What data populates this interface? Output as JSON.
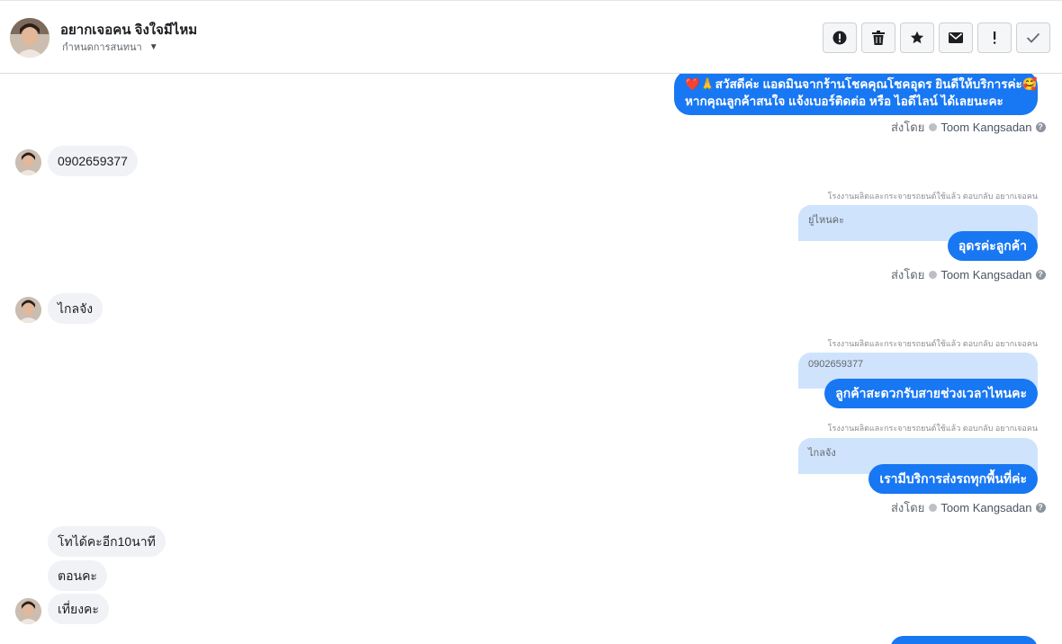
{
  "header": {
    "name": "อยากเจอคน จิงใจมีไหม",
    "subtitle": "กำหนดการสนทนา",
    "actions": [
      {
        "icon": "alert-icon",
        "label": "!"
      },
      {
        "icon": "trash-icon",
        "label": ""
      },
      {
        "icon": "star-icon",
        "label": ""
      },
      {
        "icon": "mail-icon",
        "label": ""
      },
      {
        "icon": "exclamation-icon",
        "label": "!"
      },
      {
        "icon": "check-icon",
        "label": ""
      }
    ]
  },
  "messages": {
    "greeting_line1": "❤️🙏สวัสดีค่ะ แอดมินจากร้านโชคคุณโชคอุดร ยินดีให้บริการค่ะ🥰",
    "greeting_line2": "หากคุณลูกค้าสนใจ แจ้งเบอร์ติดต่อ หรือ ไอดีไลน์ ได้เลยนะคะ",
    "sent_by_label": "ส่งโดย",
    "agent_name": "Toom Kangsadan",
    "in_phone": "0902659377",
    "reply_note": "โรงงานผลิตและกระจายรถยนต์ใช้แล้ว ตอบกลับ อยากเจอคน",
    "quote_1": "ยู่ไหนคะ",
    "out_1": "อุดรค่ะลูกค้า",
    "in_far": "ไกลจัง",
    "quote_2": "0902659377",
    "out_2": "ลูกค้าสะดวกรับสายช่วงเวลาไหนคะ",
    "quote_3": "ไกลจัง",
    "out_3": "เรามีบริการส่งรถทุกพื้นที่ค่ะ",
    "in_call": "โทได้คะอีก10นาที",
    "in_answer": "ตอนคะ",
    "in_noon": "เที่ยงคะ"
  },
  "colors": {
    "outgoing": "#1877f2",
    "quote": "#cfe3fd",
    "incoming": "#f0f2f5"
  }
}
